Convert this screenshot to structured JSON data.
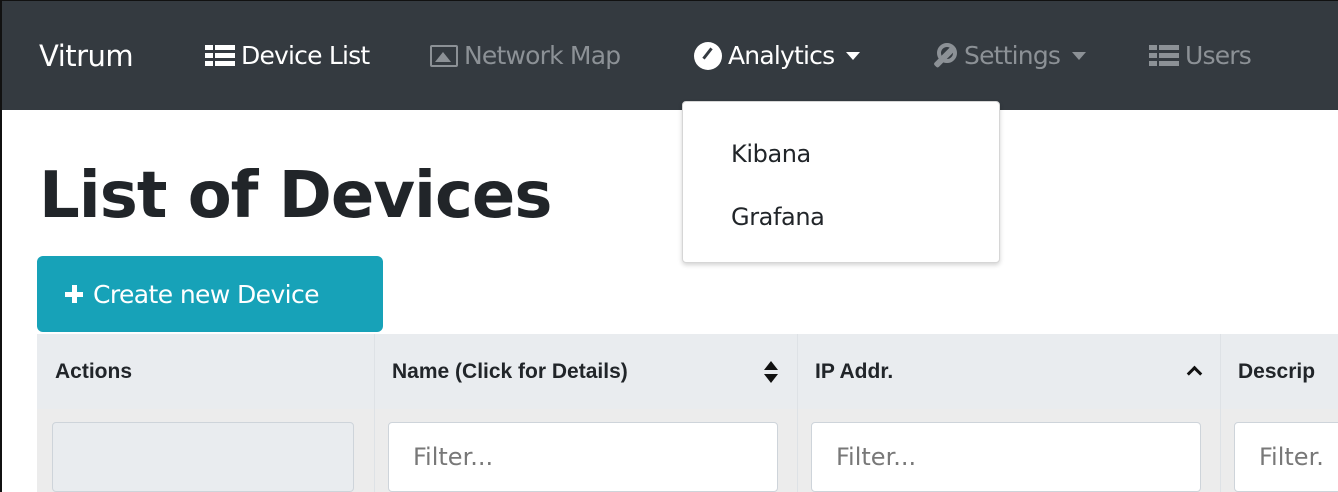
{
  "navbar": {
    "brand": "Vitrum",
    "items": [
      {
        "label": "Device List",
        "icon": "list-icon",
        "state": "active"
      },
      {
        "label": "Network Map",
        "icon": "picture-icon",
        "state": "muted"
      },
      {
        "label": "Analytics",
        "icon": "gauge-icon",
        "state": "open",
        "dropdown": true
      },
      {
        "label": "Settings",
        "icon": "wrench-icon",
        "state": "muted",
        "dropdown": true
      },
      {
        "label": "Users",
        "icon": "list-icon",
        "state": "muted"
      }
    ]
  },
  "analytics_menu": {
    "items": [
      "Kibana",
      "Grafana"
    ]
  },
  "page": {
    "title": "List of Devices",
    "create_button": "Create new Device"
  },
  "table": {
    "columns": [
      {
        "label": "Actions",
        "sort": "none"
      },
      {
        "label": "Name (Click for Details)",
        "sort": "both"
      },
      {
        "label": "IP Addr.",
        "sort": "asc"
      },
      {
        "label": "Descrip",
        "sort": "none"
      }
    ],
    "filter_placeholder": "Filter...",
    "filter_placeholder_cut": "Filter."
  },
  "colors": {
    "navbar_bg": "#343a40",
    "button_bg": "#17a2b8",
    "header_bg": "#e9ecef"
  }
}
